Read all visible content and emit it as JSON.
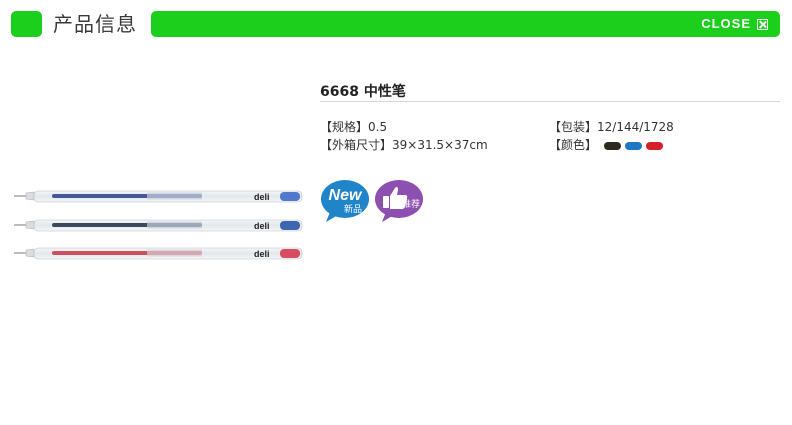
{
  "header": {
    "title": "产品信息",
    "close_label": "CLOSE",
    "accent_color": "#1ccf1c"
  },
  "product": {
    "name": "6668 中性笔",
    "specs": {
      "spec_label": "【规格】",
      "spec_value": "0.5",
      "box_label": "【外箱尺寸】",
      "box_value": "39×31.5×37cm",
      "pack_label": "【包装】",
      "pack_value": "12/144/1728",
      "color_label": "【颜色】"
    },
    "colors": [
      "#2e2a22",
      "#1f77c5",
      "#d42027"
    ],
    "image_brand": "deli",
    "badges": {
      "new_text": "New",
      "new_sub": "新品",
      "recommend_text": "推荐"
    }
  }
}
